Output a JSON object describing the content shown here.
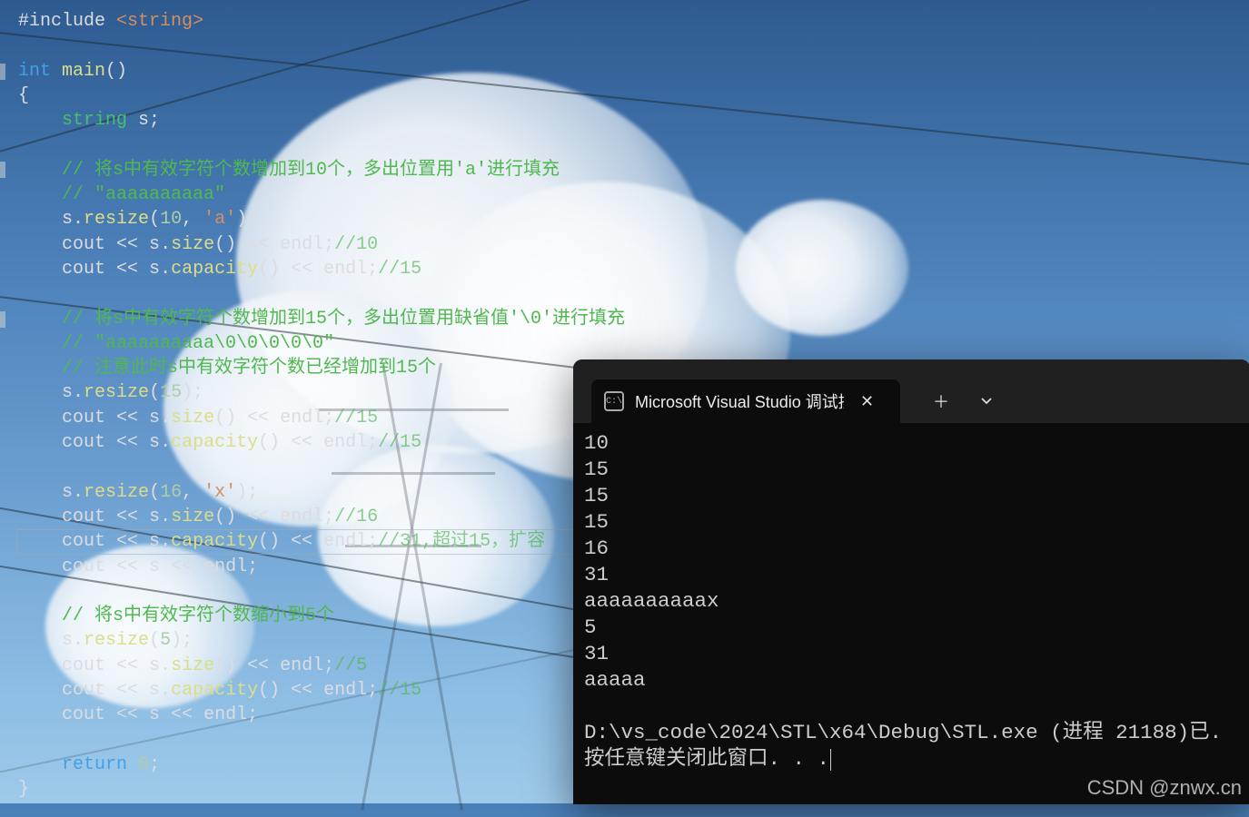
{
  "code": {
    "lines": [
      {
        "t": "include",
        "pre": "#include ",
        "str": "<string>"
      },
      {
        "t": "blank"
      },
      {
        "t": "main_sig",
        "kw1": "int",
        "kw2": "main",
        "par": "()"
      },
      {
        "t": "brace_open",
        "txt": "{"
      },
      {
        "t": "decl",
        "indent": "    ",
        "type": "string",
        "id": " s",
        "semi": ";"
      },
      {
        "t": "blank"
      },
      {
        "t": "cmt",
        "indent": "    ",
        "txt": "// 将s中有效字符个数增加到10个，多出位置用'a'进行填充"
      },
      {
        "t": "cmt",
        "indent": "    ",
        "txt": "// \"aaaaaaaaaa\""
      },
      {
        "t": "resize_str",
        "indent": "    ",
        "obj": "s",
        "fn": "resize",
        "arg1": "10",
        "arg2": "'a'"
      },
      {
        "t": "cout_fn",
        "indent": "    ",
        "obj": "s",
        "fn": "size",
        "cmt": "//10"
      },
      {
        "t": "cout_fn",
        "indent": "    ",
        "obj": "s",
        "fn": "capacity",
        "cmt": "//15"
      },
      {
        "t": "blank"
      },
      {
        "t": "cmt",
        "indent": "    ",
        "txt": "// 将s中有效字符个数增加到15个，多出位置用缺省值'\\0'进行填充"
      },
      {
        "t": "cmt",
        "indent": "    ",
        "txt": "// \"aaaaaaaaaa\\0\\0\\0\\0\\0\""
      },
      {
        "t": "cmt",
        "indent": "    ",
        "txt": "// 注意此时s中有效字符个数已经增加到15个"
      },
      {
        "t": "resize_n",
        "indent": "    ",
        "obj": "s",
        "fn": "resize",
        "arg1": "15"
      },
      {
        "t": "cout_fn",
        "indent": "    ",
        "obj": "s",
        "fn": "size",
        "cmt": "//15"
      },
      {
        "t": "cout_fn",
        "indent": "    ",
        "obj": "s",
        "fn": "capacity",
        "cmt": "//15"
      },
      {
        "t": "blank"
      },
      {
        "t": "resize_str",
        "indent": "    ",
        "obj": "s",
        "fn": "resize",
        "arg1": "16",
        "arg2": "'x'"
      },
      {
        "t": "cout_fn",
        "indent": "    ",
        "obj": "s",
        "fn": "size",
        "cmt": "//16"
      },
      {
        "t": "cout_fn",
        "indent": "    ",
        "obj": "s",
        "fn": "capacity",
        "cmt": "//31,超过15，扩容"
      },
      {
        "t": "cout_var",
        "indent": "    ",
        "obj": "s"
      },
      {
        "t": "blank"
      },
      {
        "t": "cmt",
        "indent": "    ",
        "txt": "// 将s中有效字符个数缩小到5个"
      },
      {
        "t": "resize_n",
        "indent": "    ",
        "obj": "s",
        "fn": "resize",
        "arg1": "5"
      },
      {
        "t": "cout_fn",
        "indent": "    ",
        "obj": "s",
        "fn": "size",
        "cmt": "//5"
      },
      {
        "t": "cout_fn",
        "indent": "    ",
        "obj": "s",
        "fn": "capacity",
        "cmt": "//15"
      },
      {
        "t": "cout_var",
        "indent": "    ",
        "obj": "s"
      },
      {
        "t": "blank"
      },
      {
        "t": "return",
        "indent": "    ",
        "kw": "return",
        "val": "0"
      },
      {
        "t": "brace_close",
        "txt": "}"
      }
    ]
  },
  "terminal": {
    "tab_icon_text": "C:\\",
    "tab_title": "Microsoft Visual Studio 调试控",
    "output": [
      "10",
      "15",
      "15",
      "15",
      "16",
      "31",
      "aaaaaaaaaax",
      "5",
      "31",
      "aaaaa"
    ],
    "footer_line1": "D:\\vs_code\\2024\\STL\\x64\\Debug\\STL.exe (进程 21188)已.",
    "footer_line2": "按任意键关闭此窗口. . ."
  },
  "watermark": "CSDN @znwx.cn"
}
